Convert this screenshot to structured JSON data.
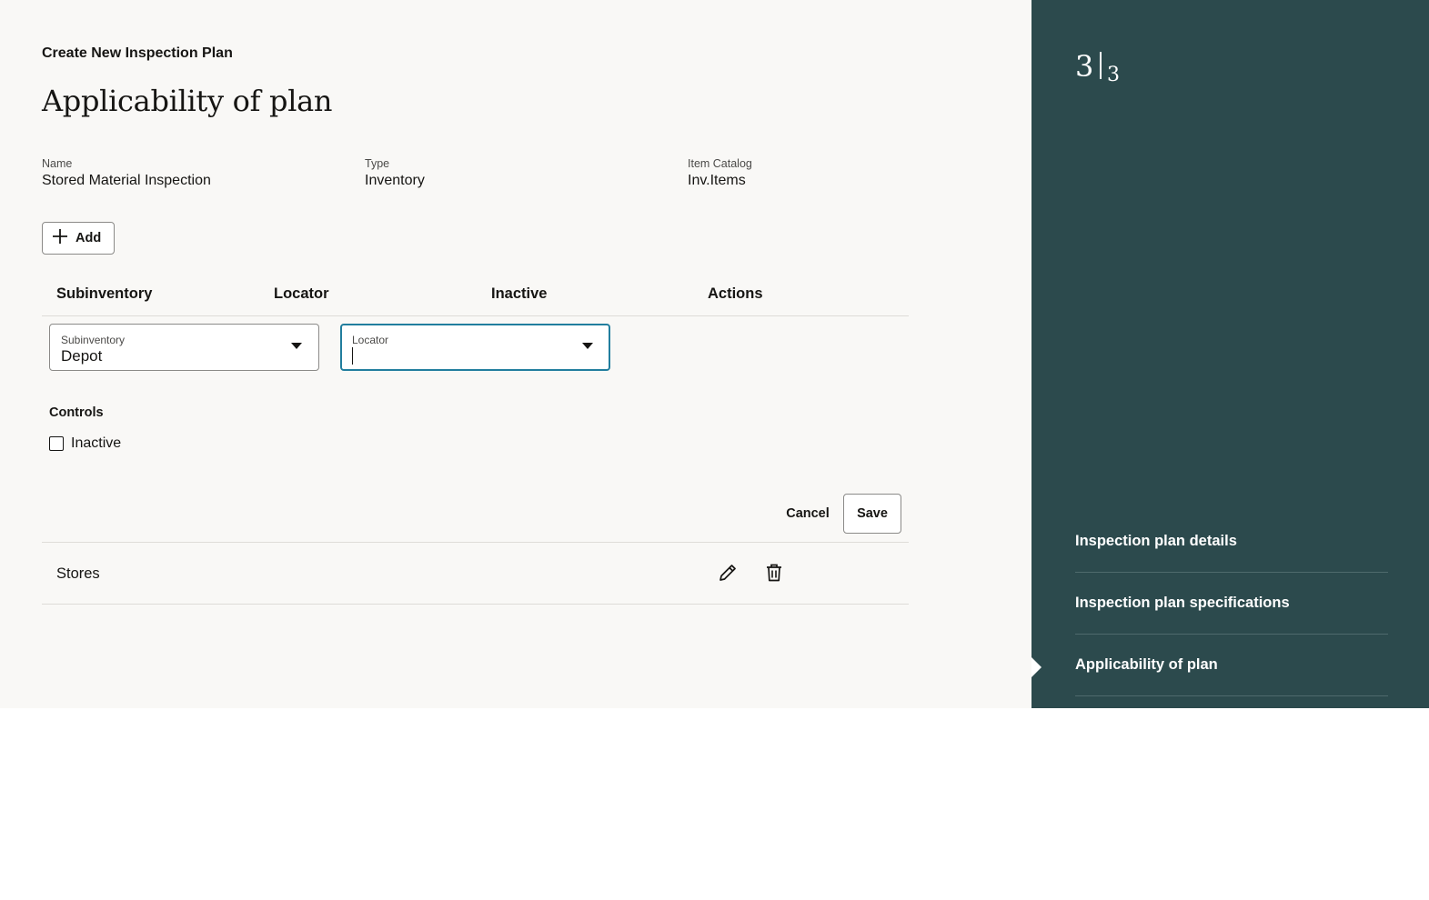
{
  "wizard": {
    "label": "Create New Inspection Plan",
    "title": "Applicability of plan"
  },
  "summary": {
    "name_label": "Name",
    "name_value": "Stored Material Inspection",
    "type_label": "Type",
    "type_value": "Inventory",
    "catalog_label": "Item Catalog",
    "catalog_value": "Inv.Items"
  },
  "toolbar": {
    "add_label": "Add",
    "add_icon": "plus-icon"
  },
  "table": {
    "columns": [
      "Subinventory",
      "Locator",
      "Inactive",
      "Actions"
    ],
    "edit_row": {
      "subinventory_label": "Subinventory",
      "subinventory_value": "Depot",
      "locator_label": "Locator",
      "locator_value": "",
      "controls_label": "Controls",
      "inactive_label": "Inactive",
      "inactive_checked": false,
      "cancel_label": "Cancel",
      "save_label": "Save"
    },
    "rows": [
      {
        "subinventory": "Stores",
        "actions": [
          "edit-icon",
          "delete-icon"
        ]
      }
    ]
  },
  "sidebar": {
    "step_current": "3",
    "step_total": "3",
    "steps": [
      {
        "label": "Inspection plan details",
        "active": false
      },
      {
        "label": "Inspection plan specifications",
        "active": false
      },
      {
        "label": "Applicability of plan",
        "active": true
      }
    ]
  },
  "colors": {
    "main_bg": "#f9f8f6",
    "sidebar_bg": "#2c4a4d",
    "focus_border": "#227e9e"
  }
}
